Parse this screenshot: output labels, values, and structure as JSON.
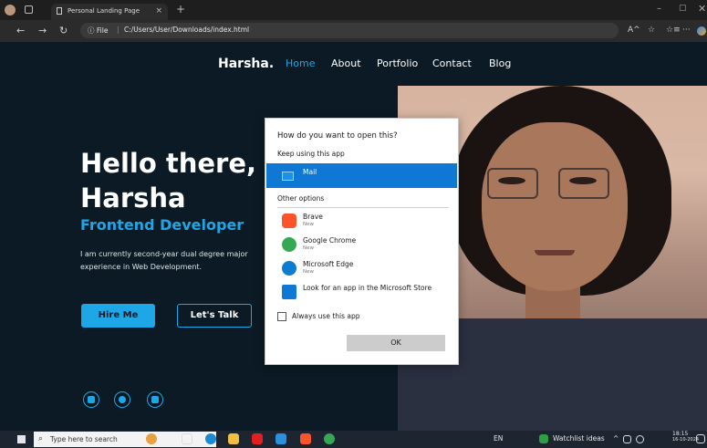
{
  "browser": {
    "tab_title": "Personal Landing Page",
    "tab_close": "×",
    "new_tab": "+",
    "url_info": "ⓘ File",
    "url_sep": "|",
    "url": "C:/Users/User/Downloads/index.html",
    "minimize": "–",
    "maximize": "▢",
    "close": "✕",
    "icons": {
      "back": "←",
      "forward": "→",
      "refresh": "↻",
      "read_aloud": "A^",
      "favorite": "☆",
      "favorites": "☆≡",
      "more": "···"
    }
  },
  "site": {
    "logo": "Harsha.",
    "nav": [
      "Home",
      "About",
      "Portfolio",
      "Contact",
      "Blog"
    ],
    "hero_line1": "Hello there, I'",
    "hero_line2": "Harsha",
    "subtitle": "Frontend Developer",
    "desc_line1": "I am currently second-year dual degree major",
    "desc_line2": "experience in Web Development.",
    "hire_btn": "Hire Me",
    "talk_btn": "Let's Talk",
    "social": [
      "linkedin-icon",
      "twitter-icon",
      "instagram-icon"
    ]
  },
  "dialog": {
    "title": "How do you want to open this?",
    "keep_label": "Keep using this app",
    "mail": "Mail",
    "other_label": "Other options",
    "apps": [
      {
        "name": "Brave",
        "sub": "New",
        "color": "#fb542b"
      },
      {
        "name": "Google Chrome",
        "sub": "New",
        "color": "#34a853"
      },
      {
        "name": "Microsoft Edge",
        "sub": "New",
        "color": "#0c7bd0"
      },
      {
        "name": "Look for an app in the Microsoft Store",
        "sub": "",
        "color": "#0f78d4"
      }
    ],
    "always_label": "Always use this app",
    "ok": "OK"
  },
  "taskbar": {
    "search_placeholder": "Type here to search",
    "search_icon": "⌕",
    "language": "EN",
    "watchlist": "Watchlist ideas",
    "tray_chevron": "^",
    "time": "18:15",
    "date": "16-10-2024"
  },
  "colors": {
    "accent": "#1ea7e6",
    "page_bg": "#0b1a24",
    "dialog_selected": "#0f78d4"
  }
}
